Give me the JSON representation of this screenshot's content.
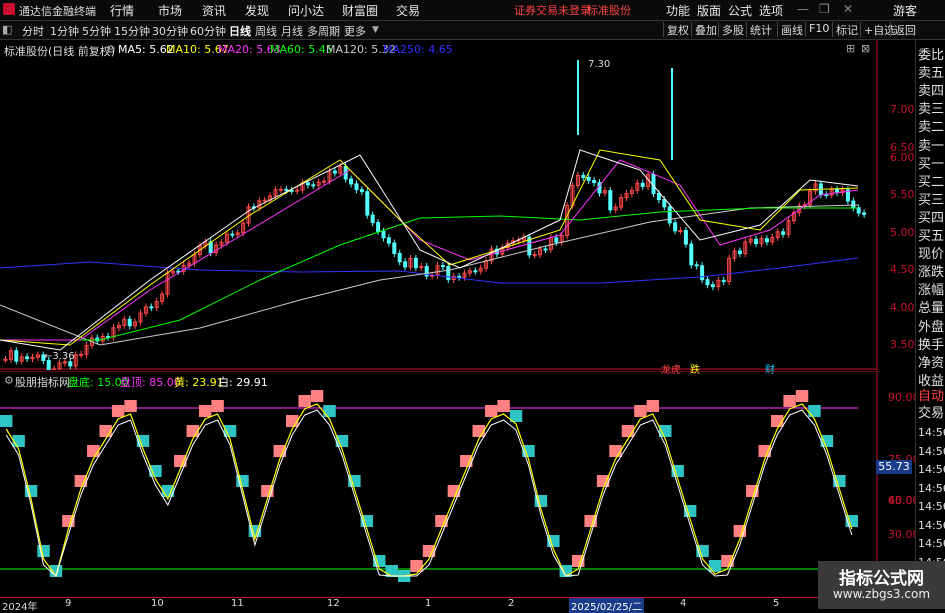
{
  "menubar": {
    "app_title": "通达信金融终端",
    "items": [
      "行情",
      "市场",
      "资讯",
      "发现",
      "问小达",
      "财富圈",
      "交易"
    ],
    "notice": "证券交易未登录",
    "stock": "标准股份",
    "right_items": [
      "功能",
      "版面",
      "公式",
      "选项"
    ],
    "user": "游客"
  },
  "periods": [
    "分时",
    "1分钟",
    "5分钟",
    "15分钟",
    "30分钟",
    "60分钟",
    "日线",
    "周线",
    "月线",
    "多周期",
    "更多"
  ],
  "active_period": "日线",
  "toolbar": [
    "复权",
    "叠加",
    "多股",
    "统计",
    "画线",
    "F10",
    "标记",
    "+自选",
    "返回"
  ],
  "main": {
    "stock_label": "标准股份(日线 前复权)",
    "ma": [
      {
        "label": "MA5: 5.62",
        "color": "#ffffff"
      },
      {
        "label": "MA10: 5.67",
        "color": "#ffff00"
      },
      {
        "label": "MA20: 5.63",
        "color": "#ff33ff"
      },
      {
        "label": "MA60: 5.45",
        "color": "#00ff00"
      },
      {
        "label": "MA120: 5.32",
        "color": "#cccccc"
      },
      {
        "label": "MA250: 4.65",
        "color": "#3333ff"
      }
    ],
    "y_ticks": [
      "7.00",
      "6.50",
      "6.00",
      "5.50",
      "5.00",
      "4.50",
      "4.00",
      "3.50"
    ],
    "high_label": "7.30",
    "low_label": "3.36",
    "markers": [
      "龙虎",
      "跌",
      "财"
    ]
  },
  "indicator": {
    "name": "股朋指标网",
    "items": [
      {
        "label": "盘底: 15.00",
        "color": "#00ff00"
      },
      {
        "label": "盘顶: 85.00",
        "color": "#ff33ff"
      },
      {
        "label": "黄: 23.91",
        "color": "#ffff00"
      },
      {
        "label": "白: 29.91",
        "color": "#ffffff"
      }
    ],
    "y_ticks": [
      "90.00",
      "75.00",
      "60.00",
      "45.00",
      "30.00"
    ],
    "current_value": "55.73"
  },
  "right_panel": [
    "委比",
    "卖五",
    "卖四",
    "卖三",
    "卖二",
    "卖一",
    "买一",
    "买二",
    "买三",
    "买四",
    "买五",
    "现价",
    "涨跌",
    "涨幅",
    "总量",
    "外盘",
    "换手",
    "净资",
    "收益"
  ],
  "right_panel2": [
    "自动",
    "交易"
  ],
  "right_times": [
    "14:56",
    "14:56",
    "14:56",
    "14:56",
    "14:56",
    "14:56",
    "14:56",
    "14:56"
  ],
  "x_labels": [
    "2024年",
    "9",
    "10",
    "11",
    "12",
    "1",
    "2",
    "2025/02/25/二",
    "4",
    "5"
  ],
  "watermark": {
    "line1": "指标公式网",
    "line2": "www.zbgs3.com"
  }
}
